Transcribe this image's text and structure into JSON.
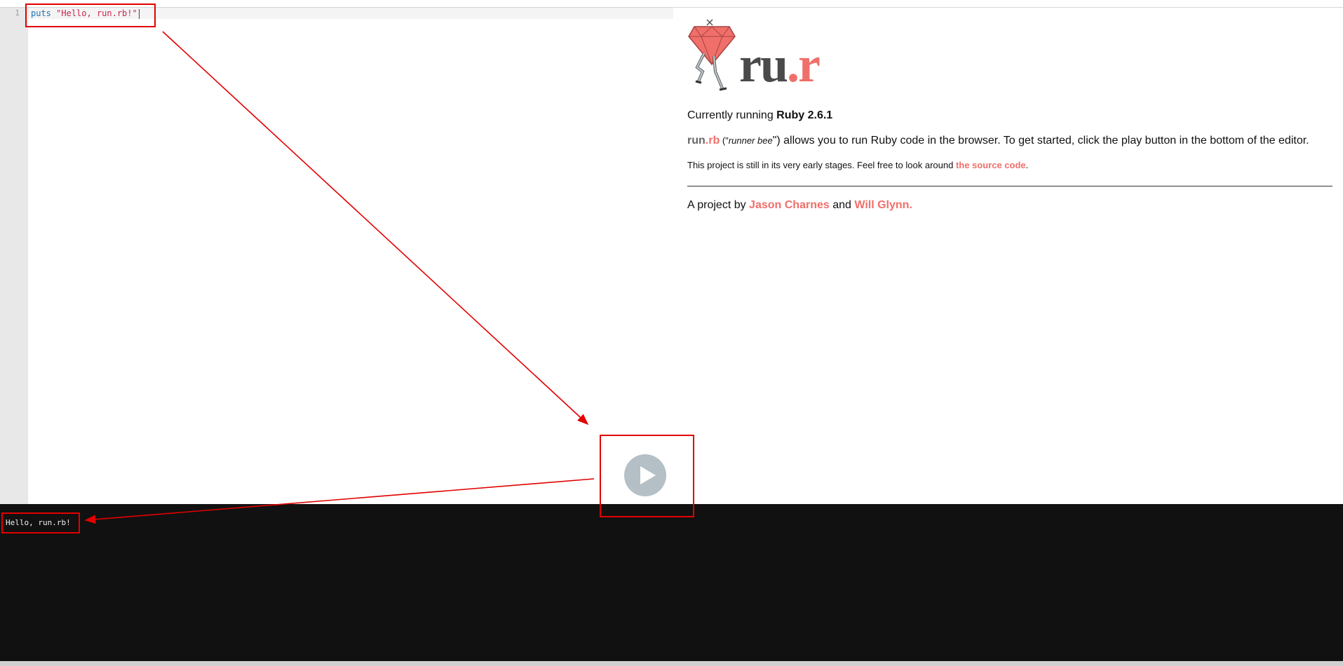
{
  "editor": {
    "line_number": "1",
    "code_keyword": "puts",
    "code_string": "\"Hello, run.rb!\""
  },
  "info": {
    "logo_run": "ru",
    "logo_dot": ".",
    "logo_r": "r",
    "running_prefix": "Currently running ",
    "running_version": "Ruby 2.6.1",
    "desc_run": "run",
    "desc_rb": ".rb",
    "desc_open": " (\"",
    "desc_italic": "runner bee",
    "desc_rest": "\") allows you to run Ruby code in the browser. To get started, click the play button in the bottom of the editor.",
    "note_text": "This project is still in its very early stages. Feel free to look around ",
    "note_link": "the source code",
    "note_end": ".",
    "credits_prefix": "A project by ",
    "author1": "Jason Charnes",
    "credits_and": " and ",
    "author2": "Will Glynn."
  },
  "console": {
    "output": "Hello, run.rb!"
  },
  "colors": {
    "accent": "#f06f6a",
    "annotation": "#e20000",
    "console_bg": "#111111",
    "play_button": "#b4c0c6"
  },
  "icons": [
    "ruby-gem-logo-icon",
    "play-icon"
  ]
}
